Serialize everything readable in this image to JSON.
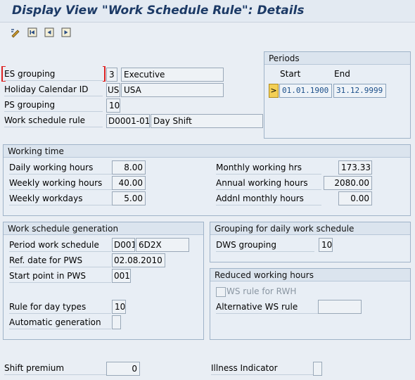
{
  "window": {
    "title": "Display View \"Work Schedule Rule\": Details"
  },
  "toolbar": {
    "icons": [
      "display-change-icon",
      "first-entry-icon",
      "previous-entry-icon",
      "next-entry-icon"
    ]
  },
  "header_fields": {
    "es_grouping": {
      "label": "ES grouping",
      "code": "3",
      "text": "Executive"
    },
    "holiday_calendar": {
      "label": "Holiday Calendar ID",
      "code": "US",
      "text": "USA"
    },
    "ps_grouping": {
      "label": "PS grouping",
      "code": "10"
    },
    "work_schedule_rule": {
      "label": "Work schedule rule",
      "code": "D0001-01",
      "text": "Day Shift"
    }
  },
  "periods": {
    "title": "Periods",
    "start_label": "Start",
    "end_label": "End",
    "select_symbol": ">",
    "start": "01.01.1900",
    "end": "31.12.9999"
  },
  "working_time": {
    "title": "Working time",
    "daily_hours": {
      "label": "Daily working hours",
      "value": "8.00"
    },
    "weekly_hours": {
      "label": "Weekly working hours",
      "value": "40.00"
    },
    "weekly_workdays": {
      "label": "Weekly workdays",
      "value": "5.00"
    },
    "monthly_hrs": {
      "label": "Monthly working hrs",
      "value": "173.33"
    },
    "annual_hours": {
      "label": "Annual working hours",
      "value": "2080.00"
    },
    "addnl_monthly": {
      "label": "Addnl monthly hours",
      "value": "0.00"
    }
  },
  "ws_generation": {
    "title": "Work schedule generation",
    "period_ws": {
      "label": "Period work schedule",
      "code": "D001",
      "text": "6D2X"
    },
    "ref_date": {
      "label": "Ref. date for PWS",
      "value": "02.08.2010"
    },
    "start_point": {
      "label": "Start point in PWS",
      "value": "001"
    },
    "rule_day_types": {
      "label": "Rule for day types",
      "value": "10"
    },
    "automatic_generation": {
      "label": "Automatic generation",
      "checked": false
    }
  },
  "grouping_daily": {
    "title": "Grouping for daily work schedule",
    "dws_grouping": {
      "label": "DWS grouping",
      "value": "10"
    }
  },
  "reduced_hours": {
    "title": "Reduced working hours",
    "ws_rule_rwh": {
      "label": "WS rule for RWH",
      "checked": false
    },
    "alt_ws_rule": {
      "label": "Alternative WS rule",
      "value": ""
    }
  },
  "footer": {
    "shift_premium": {
      "label": "Shift premium",
      "value": "0"
    },
    "illness_indicator": {
      "label": "Illness Indicator",
      "checked": false
    }
  },
  "colors": {
    "title": "#1c3a66",
    "frame": "#9fb3c8",
    "date_text": "#1b4f8a",
    "select_button": "#f3cf55"
  }
}
